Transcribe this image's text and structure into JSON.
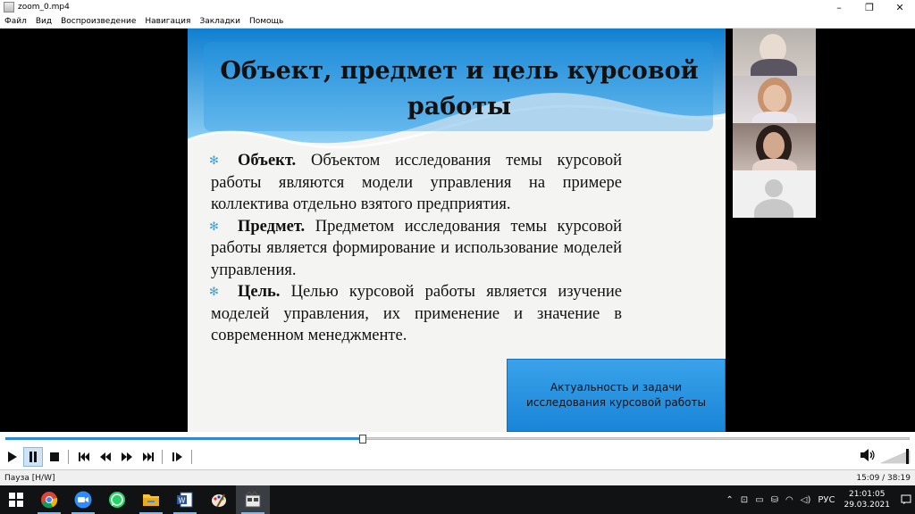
{
  "window": {
    "title": "zoom_0.mp4",
    "minimize": "–",
    "maximize": "❐",
    "close": "✕"
  },
  "menu": [
    "Файл",
    "Вид",
    "Воспроизведение",
    "Навигация",
    "Закладки",
    "Помощь"
  ],
  "slide": {
    "title_line1": "Объект, предмет и цель курсовой",
    "title_line2": "работы",
    "bullets": [
      {
        "term": "Объект.",
        "text": " Объектом исследования темы курсовой работы являются модели управления на примере коллектива отдельно взятого предприятия."
      },
      {
        "term": "Предмет.",
        "text": " Предметом исследования темы курсовой работы является формирование и использование моделей управления."
      },
      {
        "term": "Цель.",
        "text": " Целью курсовой работы является изучение моделей управления, их применение и значение в современном менеджменте."
      }
    ],
    "bullet_marker": "✻",
    "link_text": "Актуальность и задачи исследования курсовой работы"
  },
  "player": {
    "progress": 0.395,
    "status": "Пауза [H/W]",
    "time": "15:09 / 38:19",
    "volume": 1.0
  },
  "taskbar": {
    "apps": [
      "chrome-icon",
      "zoom-icon",
      "whatsapp-icon",
      "file-explorer-icon",
      "word-icon",
      "paint-icon",
      "media-player-icon"
    ],
    "lang": "РУС",
    "time": "21:01:05",
    "date": "29.03.2021"
  },
  "colors": {
    "accent": "#2b89d8",
    "slide_wave": "#1a8fd8",
    "link_box": "#2b95e3"
  }
}
